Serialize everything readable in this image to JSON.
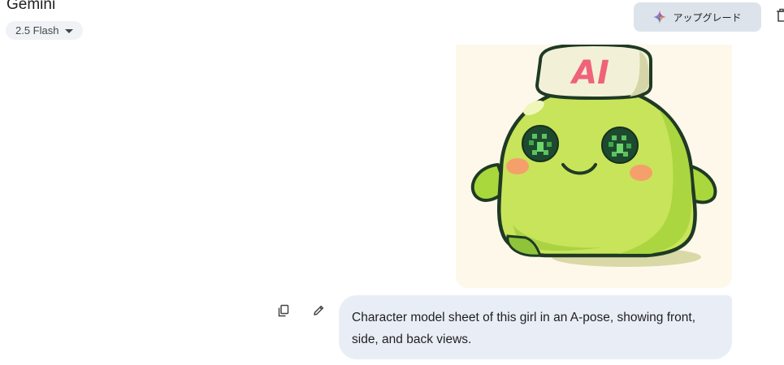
{
  "header": {
    "app_title": "Gemini",
    "model_label": "2.5 Flash",
    "upgrade_label": "アップグレード"
  },
  "icons": {
    "model_caret": "caret-down-icon",
    "upgrade": "sparkle-icon",
    "copy": "copy-icon",
    "edit": "pencil-icon"
  },
  "conversation": {
    "image_alt": "Green blob mascot wearing an AI cap",
    "image_cap_text": "AI",
    "user_prompt": "Character model sheet of this girl in an A-pose, showing front, side, and back views."
  },
  "colors": {
    "chip_bg": "#f0f2f5",
    "upgrade_bg": "#dde3ea",
    "bubble_bg": "#e9eef6",
    "image_bg": "#fdf8e9"
  }
}
